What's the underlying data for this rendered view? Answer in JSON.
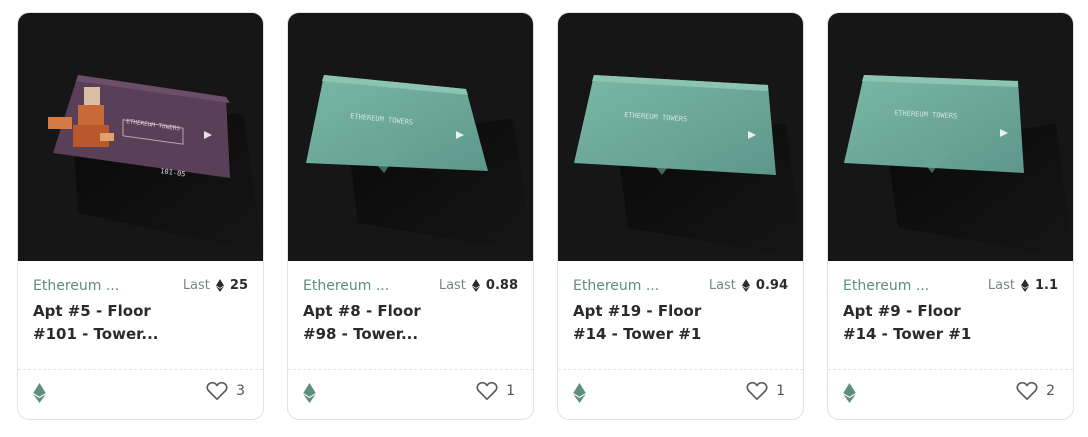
{
  "cards": [
    {
      "collection": "Ethereum ...",
      "last_label": "Last",
      "price": "25",
      "title_line1": "Apt #5 - Floor",
      "title_line2": "#101 - Tower...",
      "likes": "3",
      "card_style": "purple"
    },
    {
      "collection": "Ethereum ...",
      "last_label": "Last",
      "price": "0.88",
      "title_line1": "Apt #8 - Floor",
      "title_line2": "#98 - Tower...",
      "likes": "1",
      "card_style": "teal"
    },
    {
      "collection": "Ethereum ...",
      "last_label": "Last",
      "price": "0.94",
      "title_line1": "Apt #19 - Floor",
      "title_line2": "#14 - Tower #1",
      "likes": "1",
      "card_style": "teal"
    },
    {
      "collection": "Ethereum ...",
      "last_label": "Last",
      "price": "1.1",
      "title_line1": "Apt #9 - Floor",
      "title_line2": "#14 - Tower #1",
      "likes": "2",
      "card_style": "teal"
    }
  ],
  "card_art_label": "ETHEREUM TOWERS",
  "card_art_footer_purple": "101-05",
  "colors": {
    "accent": "#5f8d80",
    "teal_card": "#6ea796",
    "purple_card": "#5a3f58",
    "media_bg": "#161616"
  },
  "icons": {
    "price_currency": "ethereum-icon",
    "chain": "ethereum-icon",
    "like": "heart-outline-icon"
  }
}
